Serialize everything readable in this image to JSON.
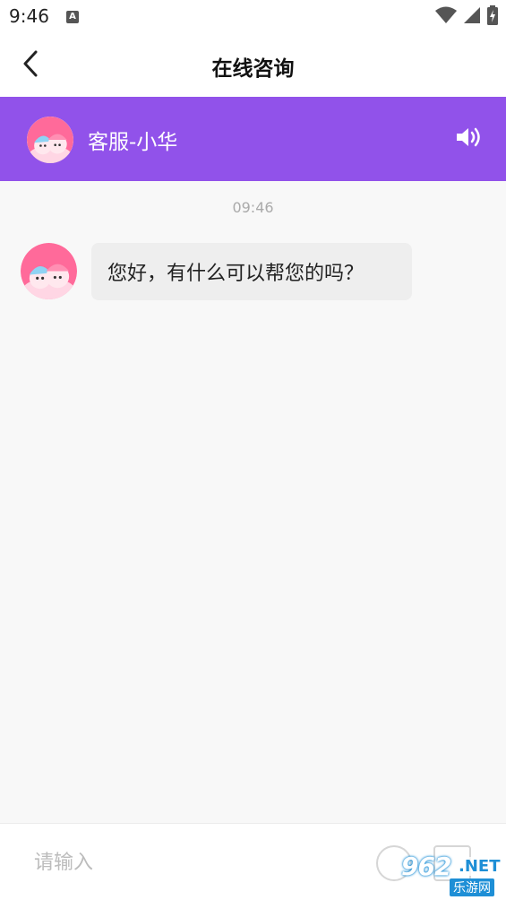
{
  "status_bar": {
    "time": "9:46",
    "notification_badge": "A",
    "icons": [
      "wifi-icon",
      "cell-signal-icon",
      "battery-icon"
    ]
  },
  "nav": {
    "title": "在线咨询",
    "back_icon": "chevron-left-icon"
  },
  "agent_bar": {
    "name": "客服-小华",
    "speaker_icon": "speaker-icon",
    "background_color": "#9152ea"
  },
  "chat": {
    "timestamp": "09:46",
    "messages": [
      {
        "sender": "agent",
        "text": "您好，有什么可以帮您的吗？"
      }
    ]
  },
  "input_bar": {
    "placeholder": "请输入",
    "emoji_icon": "emoji-icon",
    "image_icon": "image-icon"
  },
  "watermark": {
    "brand": "962",
    "suffix": ".NET",
    "site": "乐游网"
  }
}
